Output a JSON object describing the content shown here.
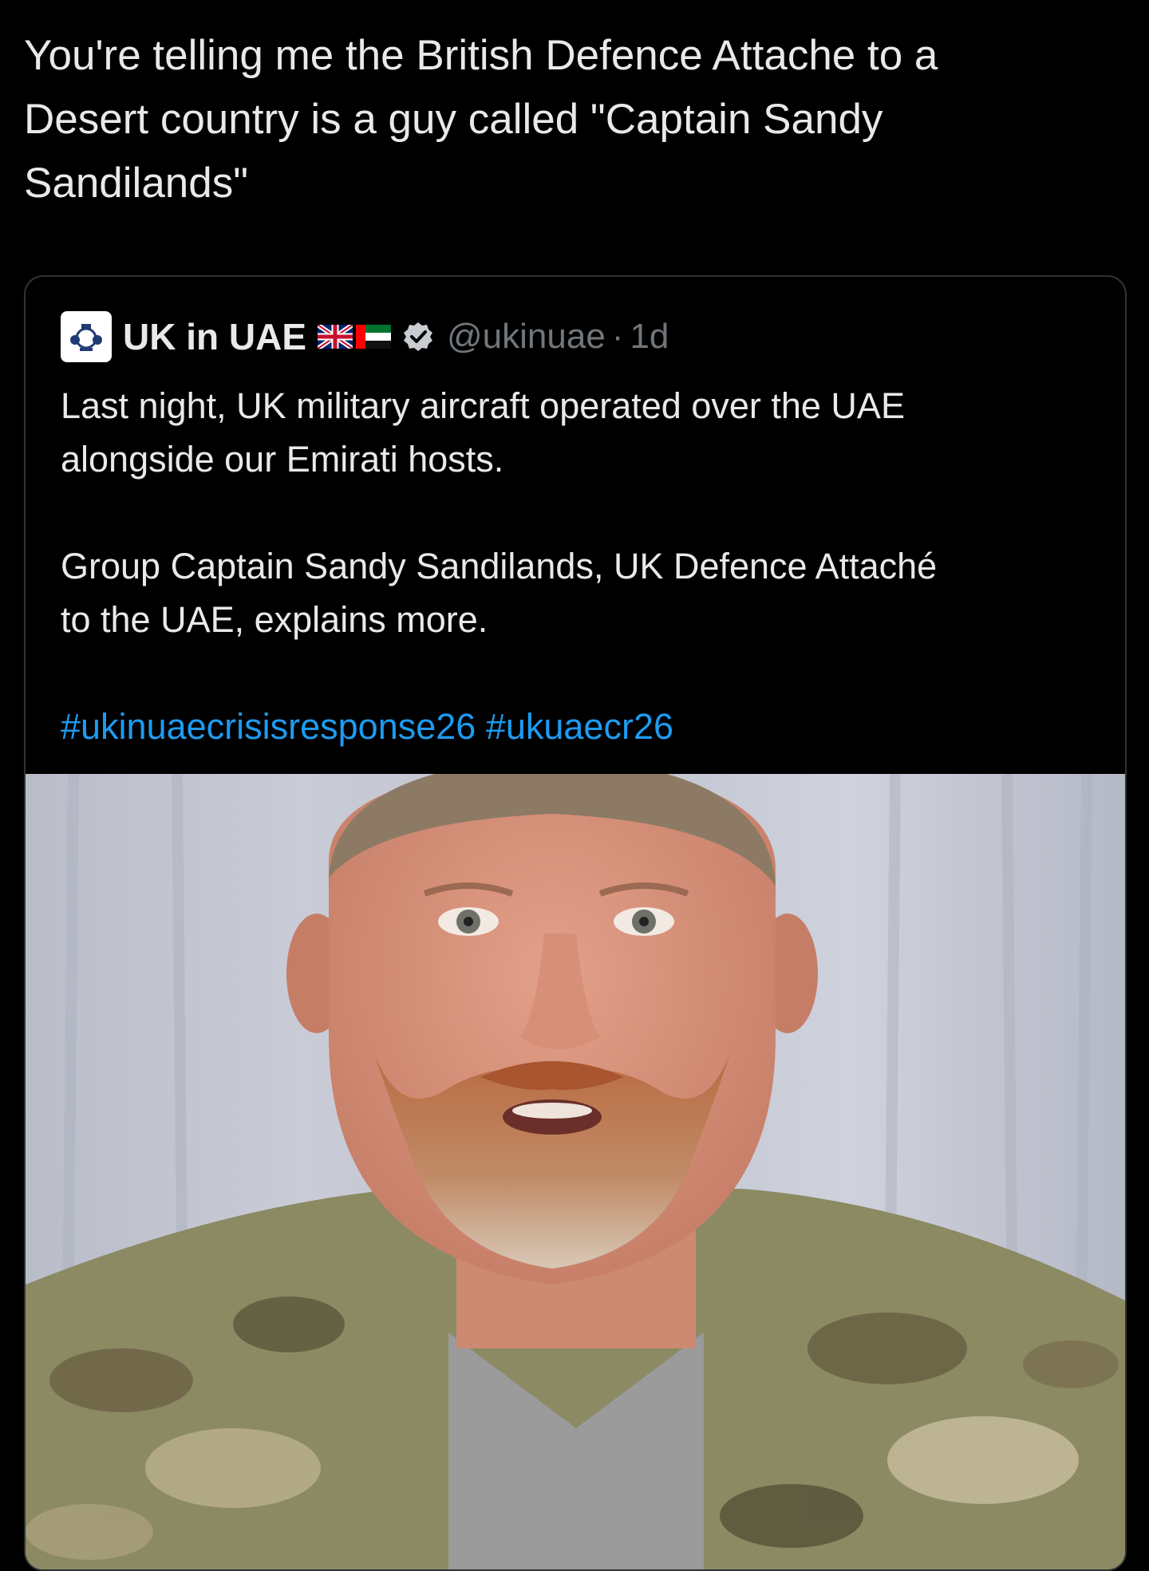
{
  "post": {
    "text": "You're telling me the British Defence Attache to a\nDesert country is a guy called \"Captain Sandy\nSandilands\""
  },
  "quoted_post": {
    "display_name": "UK in UAE",
    "flag_icons": [
      "uk-flag-icon",
      "uae-flag-icon"
    ],
    "verified_icon": "verified-badge-icon",
    "handle": "@ukinuae",
    "separator": "·",
    "timestamp": "1d",
    "paragraphs": [
      "Last night, UK military aircraft operated over the UAE\nalongside our Emirati hosts.",
      "Group Captain Sandy Sandilands, UK Defence Attaché\nto the UAE, explains more."
    ],
    "hashtags": [
      "#ukinuaecrisisresponse26",
      "#ukuaecr26"
    ],
    "media": {
      "type": "video-thumbnail",
      "icon": "video-person-image"
    }
  },
  "colors": {
    "background": "#000000",
    "text": "#e7e9ea",
    "secondary_text": "#71767b",
    "link": "#1d9bf0",
    "border": "#2f3336"
  }
}
